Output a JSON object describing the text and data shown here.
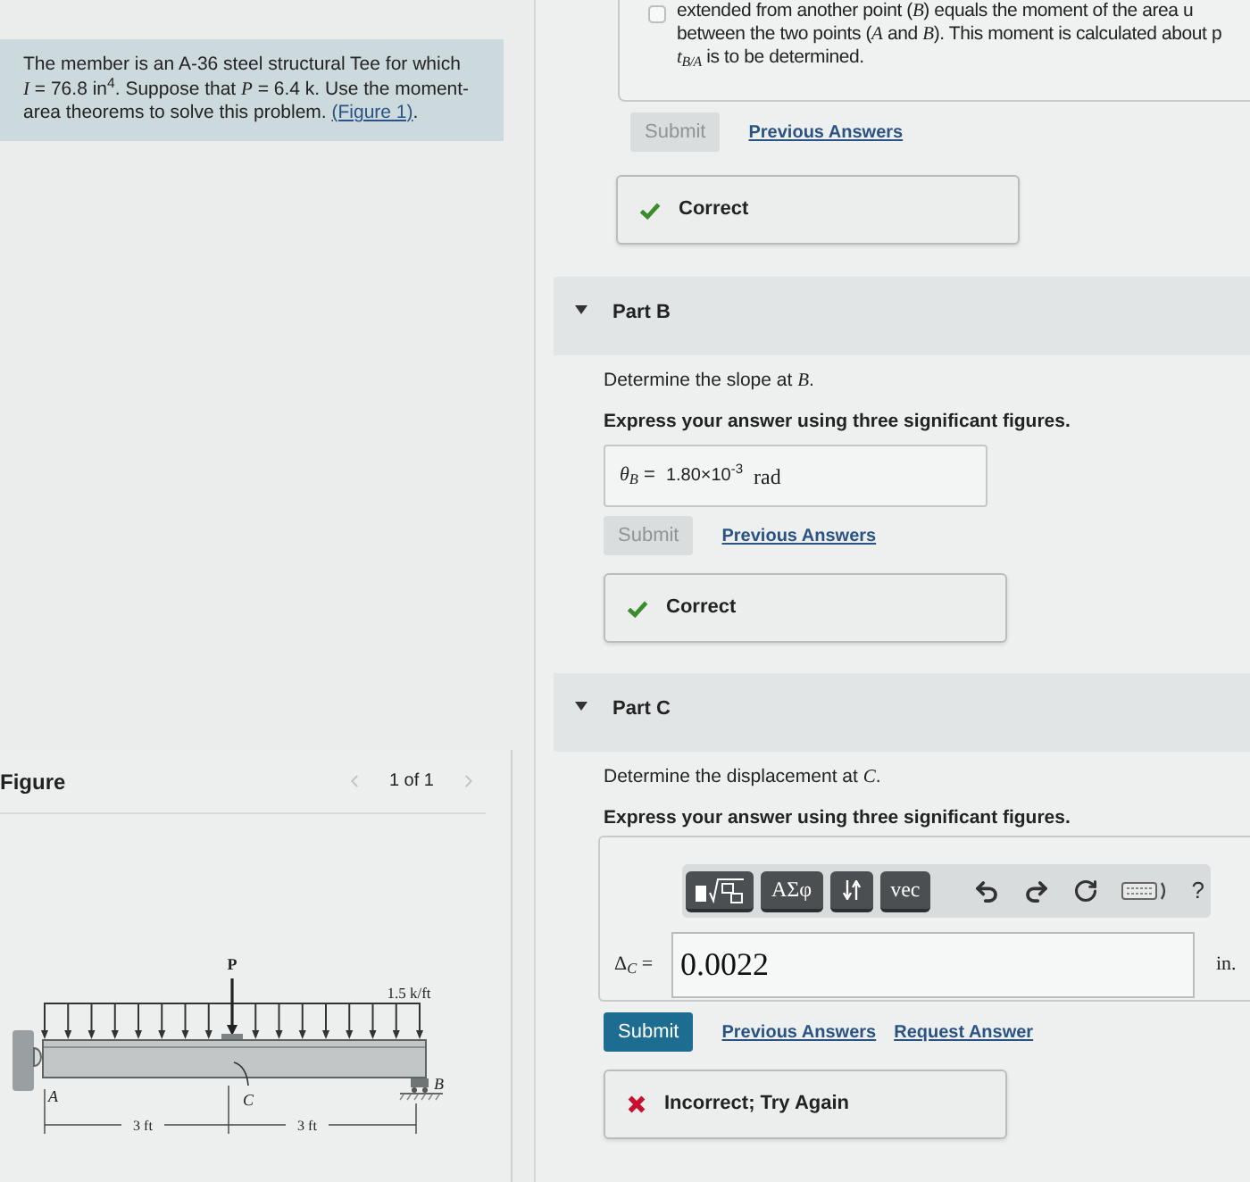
{
  "problem": {
    "text": "The member is an A-36 steel structural Tee for which *I* = 76.8 in$^{4}$. Suppose that *P* = 6.4 k. Use the moment-area theorems to solve this problem. ",
    "link": "(Figure 1)",
    "after": "."
  },
  "figure": {
    "title": "Figure",
    "pager": "1 of 1",
    "prev": {
      "disabled": true
    },
    "next": {
      "disabled": true
    },
    "labels": {
      "load": "P",
      "intensity": "1.5 k/ft",
      "end_a": "A",
      "end_b": "B",
      "point_c": "C",
      "span_1": "3 ft",
      "span_2": "3 ft"
    }
  },
  "part_a": {
    "hint_lines": [
      "extended from another point (*B*) equals the moment of the area u",
      "between the two points (*A* and *B*). This moment is calculated about p",
      "*t*$_{B/A}$ is to be determined."
    ],
    "submit": {
      "label": "Submit",
      "disabled": true
    },
    "links": [
      "Previous Answers"
    ],
    "feedback": {
      "correct": true,
      "text": "Correct"
    }
  },
  "parts": [
    {
      "title": "Part B",
      "expanded": true,
      "prompt": "Determine the slope at *B*.",
      "instruction": "Express your answer using three significant figures.",
      "answer": {
        "kind": "result",
        "label": "*θ*$_{B}$ =",
        "value": "1.80×10$^{-3}$",
        "unit": "rad"
      },
      "submit": {
        "label": "Submit",
        "disabled": true
      },
      "links": [
        "Previous Answers"
      ],
      "feedback": {
        "correct": true,
        "text": "Correct"
      }
    },
    {
      "title": "Part C",
      "expanded": true,
      "prompt": "Determine the displacement at *C*.",
      "instruction": "Express your answer using three significant figures.",
      "answer": {
        "kind": "editor",
        "toolbar": [
          {
            "kind": "template"
          },
          {
            "kind": "text",
            "label": "ΑΣφ"
          },
          {
            "kind": "arrows"
          },
          {
            "kind": "text",
            "label": "vec"
          },
          {
            "kind": "undo"
          },
          {
            "kind": "redo"
          },
          {
            "kind": "reset"
          },
          {
            "kind": "keyboard"
          },
          {
            "kind": "help",
            "label": "?"
          }
        ],
        "label": "Δ$_{C}$ =",
        "value": "0.0022",
        "unit": "in."
      },
      "submit": {
        "label": "Submit",
        "disabled": false
      },
      "links": [
        "Previous Answers",
        "Request Answer"
      ],
      "feedback": {
        "correct": false,
        "text": "Incorrect; Try Again"
      }
    }
  ]
}
